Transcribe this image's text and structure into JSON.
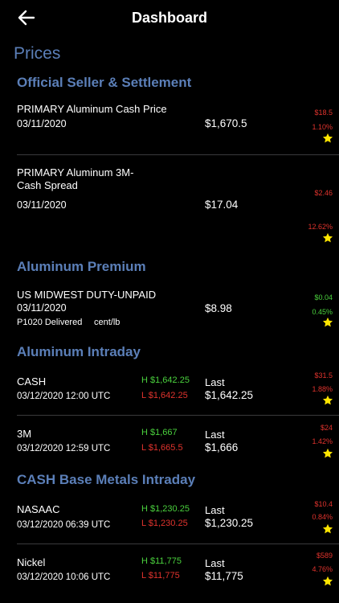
{
  "header": {
    "title": "Dashboard",
    "back_icon": "back-arrow-icon"
  },
  "prices_label": "Prices",
  "sections": {
    "official": "Official Seller & Settlement",
    "premium": "Aluminum Premium",
    "intraday": "Aluminum Intraday",
    "base_metals": "CASH Base Metals Intraday"
  },
  "official_items": [
    {
      "name": "PRIMARY Aluminum Cash Price",
      "date": "03/11/2020",
      "price": "$1,670.5",
      "change": "$18.5",
      "pct": "1.10%"
    },
    {
      "name_line1": "PRIMARY Aluminum 3M-",
      "name_line2": "Cash Spread",
      "date": "03/11/2020",
      "price": "$17.04",
      "change": "$2.46",
      "pct": "12.62%"
    }
  ],
  "premium_item": {
    "name": "US MIDWEST DUTY-UNPAID",
    "date": "03/11/2020",
    "price": "$8.98",
    "delivery": "P1020 Delivered",
    "unit": "cent/lb",
    "change": "$0.04",
    "pct": "0.45%"
  },
  "intraday_items": [
    {
      "name": "CASH",
      "date": "03/12/2020 12:00 UTC",
      "high": "H $1,642.25",
      "low": "L $1,642.25",
      "last_label": "Last",
      "last": "$1,642.25",
      "change": "$31.5",
      "pct": "1.88%"
    },
    {
      "name": "3M",
      "date": "03/12/2020 12:59 UTC",
      "high": "H $1,667",
      "low": "L $1,665.5",
      "last_label": "Last",
      "last": "$1,666",
      "change": "$24",
      "pct": "1.42%"
    }
  ],
  "base_items": [
    {
      "name": "NASAAC",
      "date": "03/12/2020 06:39 UTC",
      "high": "H $1,230.25",
      "low": "L $1,230.25",
      "last_label": "Last",
      "last": "$1,230.25",
      "change": "$10.4",
      "pct": "0.84%"
    },
    {
      "name": "Nickel",
      "date": "03/12/2020 10:06 UTC",
      "high": "H $11,775",
      "low": "L $11,775",
      "last_label": "Last",
      "last": "$11,775",
      "change": "$589",
      "pct": "4.76%"
    }
  ],
  "colors": {
    "accent": "#5b7fb8",
    "negative": "#e0332d",
    "positive": "#4ad13d",
    "star": "#ffe500"
  }
}
